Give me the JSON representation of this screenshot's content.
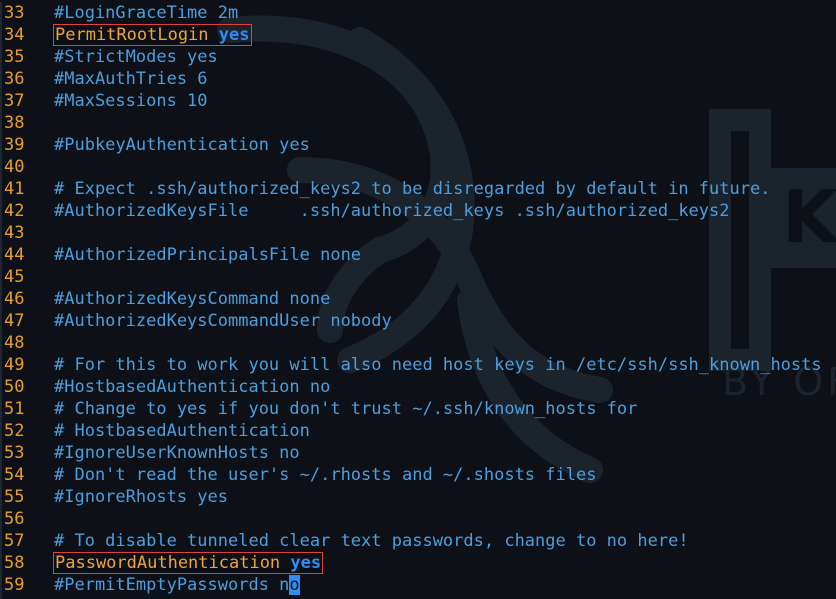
{
  "editor": {
    "lines": [
      {
        "num": "33",
        "kind": "comment",
        "text": "#LoginGraceTime 2m"
      },
      {
        "num": "34",
        "kind": "directive",
        "key": "PermitRootLogin",
        "value": "yes",
        "highlight": true
      },
      {
        "num": "35",
        "kind": "comment",
        "text": "#StrictModes yes"
      },
      {
        "num": "36",
        "kind": "comment",
        "text": "#MaxAuthTries 6"
      },
      {
        "num": "37",
        "kind": "comment",
        "text": "#MaxSessions 10"
      },
      {
        "num": "38",
        "kind": "blank",
        "text": ""
      },
      {
        "num": "39",
        "kind": "comment",
        "text": "#PubkeyAuthentication yes"
      },
      {
        "num": "40",
        "kind": "blank",
        "text": ""
      },
      {
        "num": "41",
        "kind": "comment",
        "text": "# Expect .ssh/authorized_keys2 to be disregarded by default in future."
      },
      {
        "num": "42",
        "kind": "comment",
        "text": "#AuthorizedKeysFile     .ssh/authorized_keys .ssh/authorized_keys2"
      },
      {
        "num": "43",
        "kind": "blank",
        "text": ""
      },
      {
        "num": "44",
        "kind": "comment",
        "text": "#AuthorizedPrincipalsFile none"
      },
      {
        "num": "45",
        "kind": "blank",
        "text": ""
      },
      {
        "num": "46",
        "kind": "comment",
        "text": "#AuthorizedKeysCommand none"
      },
      {
        "num": "47",
        "kind": "comment",
        "text": "#AuthorizedKeysCommandUser nobody"
      },
      {
        "num": "48",
        "kind": "blank",
        "text": ""
      },
      {
        "num": "49",
        "kind": "comment",
        "text": "# For this to work you will also need host keys in /etc/ssh/ssh_known_hosts"
      },
      {
        "num": "50",
        "kind": "comment",
        "text": "#HostbasedAuthentication no"
      },
      {
        "num": "51",
        "kind": "comment",
        "text": "# Change to yes if you don't trust ~/.ssh/known_hosts for"
      },
      {
        "num": "52",
        "kind": "comment",
        "text": "# HostbasedAuthentication"
      },
      {
        "num": "53",
        "kind": "comment",
        "text": "#IgnoreUserKnownHosts no"
      },
      {
        "num": "54",
        "kind": "comment",
        "text": "# Don't read the user's ~/.rhosts and ~/.shosts files"
      },
      {
        "num": "55",
        "kind": "comment",
        "text": "#IgnoreRhosts yes"
      },
      {
        "num": "56",
        "kind": "blank",
        "text": ""
      },
      {
        "num": "57",
        "kind": "comment",
        "text": "# To disable tunneled clear text passwords, change to no here!"
      },
      {
        "num": "58",
        "kind": "directive",
        "key": "PasswordAuthentication",
        "value": "yes",
        "highlight": true
      },
      {
        "num": "59",
        "kind": "cursorline",
        "text": "#PermitEmptyPasswords n",
        "cursor_char": "o"
      }
    ]
  },
  "watermark": {
    "text": "BY OF",
    "letter": "K",
    "icon": "kali-dragon-icon"
  },
  "colors": {
    "background": "#0d1117",
    "line_number": "#e89d2c",
    "comment": "#4a9fe0",
    "directive": "#f0a33a",
    "keyword": "#2f8df5",
    "highlight_box": "#e0413a"
  }
}
